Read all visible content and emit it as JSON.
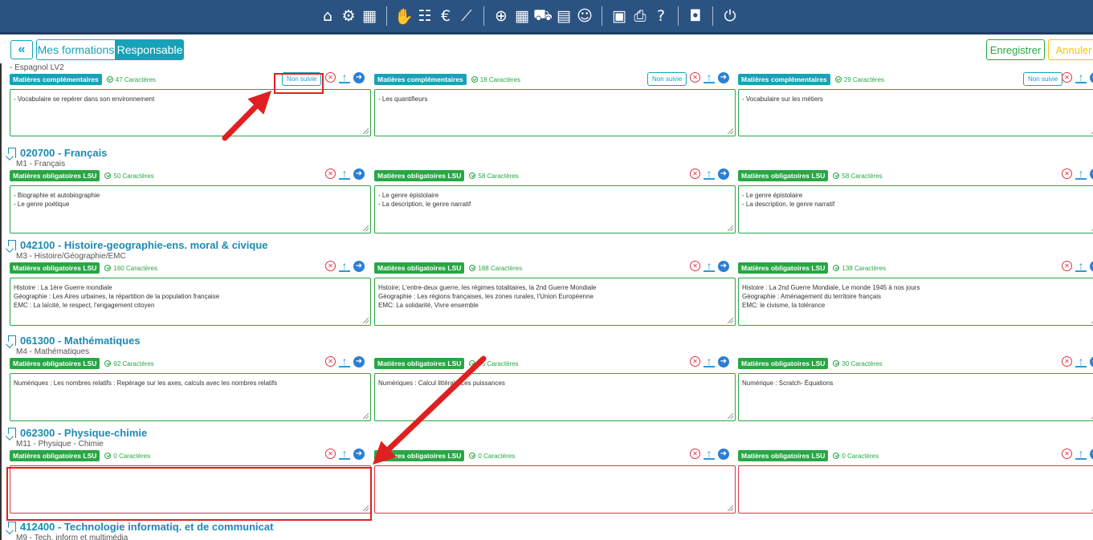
{
  "topbar": {
    "icons": [
      "home-icon",
      "gears-icon",
      "school-icon",
      "sep",
      "handshake-icon",
      "group-icon",
      "euro-icon",
      "chart-line-icon",
      "sep",
      "globe-icon",
      "calendar-icon",
      "car-icon",
      "id-card-icon",
      "user-settings-icon",
      "sep",
      "register-icon",
      "print-icon",
      "help-icon",
      "sep",
      "window-icon",
      "sep",
      "power-icon"
    ],
    "glyphs": {
      "home-icon": "⌂",
      "gears-icon": "⚙",
      "school-icon": "▦",
      "handshake-icon": "✋",
      "group-icon": "☷",
      "euro-icon": "€",
      "chart-line-icon": "⟋",
      "globe-icon": "⊕",
      "calendar-icon": "▦",
      "car-icon": "⛟",
      "id-card-icon": "▤",
      "user-settings-icon": "☺",
      "register-icon": "▣",
      "print-icon": "⎙",
      "help-icon": "?",
      "window-icon": "◘",
      "power-icon": "⏻"
    }
  },
  "toolbar": {
    "collapse_label": "«",
    "tab_mes_formations": "Mes formations",
    "tab_responsable": "Responsable",
    "save_label": "Enregistrer",
    "cancel_label": "Annuler"
  },
  "subjects": [
    {
      "code_title": "",
      "subtitle": "- Espagnol LV2",
      "columns": [
        {
          "tag": "Matières complémentaires",
          "tag_type": "comp",
          "count": "47 Caractères",
          "nonsuivi": "Non suivie",
          "text": [
            "- Vocabulaire se repérer dans son environnement"
          ]
        },
        {
          "tag": "Matières complémentaires",
          "tag_type": "comp",
          "count": "18 Caractères",
          "nonsuivi": "Non suivie",
          "text": [
            "- Les quantifieurs"
          ]
        },
        {
          "tag": "Matières complémentaires",
          "tag_type": "comp",
          "count": "29 Caractères",
          "nonsuivi": "Non suivie",
          "text": [
            "- Vocabulaire sur les métiers"
          ]
        }
      ]
    },
    {
      "code_title": "020700 - Français",
      "subtitle": "M1 - Français",
      "columns": [
        {
          "tag": "Matières obligatoires LSU",
          "tag_type": "lsu",
          "count": "50 Caractères",
          "text": [
            "- Biographie et autobiographie",
            "- Le genre poétique"
          ]
        },
        {
          "tag": "Matières obligatoires LSU",
          "tag_type": "lsu",
          "count": "58 Caractères",
          "text": [
            "- Le genre épistolaire",
            "- La description, le genre narratif"
          ]
        },
        {
          "tag": "Matières obligatoires LSU",
          "tag_type": "lsu",
          "count": "58 Caractères",
          "text": [
            "- Le genre épistolaire",
            "- La description, le genre narratif"
          ]
        }
      ]
    },
    {
      "code_title": "042100 - Histoire-geographie-ens. moral & civique",
      "subtitle": "M3 - Histoire/Géographie/EMC",
      "columns": [
        {
          "tag": "Matières obligatoires LSU",
          "tag_type": "lsu",
          "count": "160 Caractères",
          "text": [
            "Histoire : La 1ère Guerre mondiale",
            "Géographie : Les Aires urbaines, la répartition de la population française",
            "EMC : La laïcité, le respect, l'engagement citoyen"
          ]
        },
        {
          "tag": "Matières obligatoires LSU",
          "tag_type": "lsu",
          "count": "188 Caractères",
          "text": [
            "Hstoire; L'entre-deux guerre, les régimes totalitaires, la 2nd Guerre Mondiale",
            "Géographie : Les régions françaises, les zones rurales, l'Union Européenne",
            "EMC: La solidarité, Vivre ensemble"
          ]
        },
        {
          "tag": "Matières obligatoires LSU",
          "tag_type": "lsu",
          "count": "138 Caractères",
          "text": [
            "Histoire : La 2nd Guerre Mondiale, Le monde 1945 à nos jours",
            "Géographie : Aménagement du territoire français",
            "EMC: le civisme, la tolérance"
          ]
        }
      ]
    },
    {
      "code_title": "061300 - Mathématiques",
      "subtitle": "M4 - Mathématiques",
      "columns": [
        {
          "tag": "Matières obligatoires LSU",
          "tag_type": "lsu",
          "count": "92 Caractères",
          "text": [
            "Numériques : Les nombres relatifs : Repérage sur les axes, calculs avec les nombres relatifs"
          ]
        },
        {
          "tag": "Matières obligatoires LSU",
          "tag_type": "lsu",
          "count": "45 Caractères",
          "text": [
            "Numériques : Calcul littéral - Les puissances"
          ]
        },
        {
          "tag": "Matières obligatoires LSU",
          "tag_type": "lsu",
          "count": "30 Caractères",
          "text": [
            "Numérique : Scratch- Équations"
          ]
        }
      ]
    },
    {
      "code_title": "062300 - Physique-chimie",
      "subtitle": "M11 - Physique - Chimie",
      "columns": [
        {
          "tag": "Matières obligatoires LSU",
          "tag_type": "lsu",
          "count": "0 Caractères",
          "text": []
        },
        {
          "tag": "Matières obligatoires LSU",
          "tag_type": "lsu",
          "count": "0 Caractères",
          "text": []
        },
        {
          "tag": "Matières obligatoires LSU",
          "tag_type": "lsu",
          "count": "0 Caractères",
          "text": []
        }
      ]
    },
    {
      "code_title": "412400 - Technologie informatiq. et de communicat",
      "subtitle": "M9 - Tech. inform et multimédia",
      "columns": []
    }
  ],
  "action_glyphs": {
    "remove": "✕",
    "upload": "↑",
    "go": "➜"
  },
  "colors": {
    "topbar": "#2b5382",
    "accent": "#17a2b8",
    "success": "#28a745",
    "danger": "#dc3545",
    "warning": "#ffc107",
    "annotation": "#e02020"
  }
}
